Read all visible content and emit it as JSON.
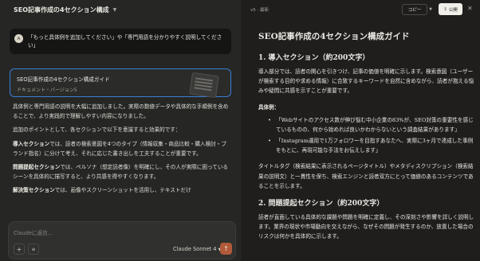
{
  "chat": {
    "title": "SEO記事作成の4セクション構成",
    "user_avatar": "A",
    "user_message": "「もっと具体例を追加してください」や「専門用語を分かりやすく説明してください」",
    "artifact": {
      "title": "SEO記事作成の4セクション構成ガイド",
      "subtitle": "ドキュメント・バージョン5"
    },
    "reply": [
      {
        "bold": "",
        "text": "具体例と専門用語の説明を大幅に追加しました。実際の数値データや具体的な手順例を含めることで、より実践的で理解しやすい内容になりました。"
      },
      {
        "bold": "",
        "text": "追加のポイントとして、各セクションで以下を意識すると効果的です："
      },
      {
        "bold": "導入セクション",
        "text": "では、読者の検索意図を4つのタイプ（情報収集・商品比較・購入検討・ブランド指名）に分けて考え、それに応じた書き出しを工夫することが重要です。"
      },
      {
        "bold": "問題提起セクション",
        "text": "では、ペルソナ（想定読者像）を明確にし、その人が実際に困っているシーンを具体的に描写すると、より共感を得やすくなります。"
      },
      {
        "bold": "解決策セクション",
        "text": "では、画像やスクリーンショットを活用し、テキストだけ"
      }
    ],
    "input_placeholder": "Claudeに返信...",
    "plus_icon": "+",
    "tools_icon": "≡",
    "model": "Claude Sonnet 4",
    "send_icon": "↑"
  },
  "artifact_panel": {
    "version": "v5 · 最新",
    "copy_label": "コピー",
    "publish_label": "公開",
    "doc": {
      "title": "SEO記事作成の4セクション構成ガイド",
      "section1_heading": "1. 導入セクション（約200文字）",
      "section1_para": "導入部分では、読者の関心を引きつけ、記事の価値を明確に示します。検索意図（ユーザーが検索する目的や求める情報）に合致するキーワードを自然に含めながら、読者が抱える悩みや疑問に共感を示すことが重要です。",
      "example_label": "具体例：",
      "examples": [
        "「Webサイトのアクセス数が伸び悩む中小企業の83%が、SEO対策の重要性を感じているものの、何から始めれば良いかわからないという調査結果があります」",
        "「Instagram運用で1万フォロワーを目指すあなたへ、実際に3ヶ月で達成した事例をもとに、再現可能な手法をお伝えします」"
      ],
      "section1_para2": "タイトルタグ（検索結果に表示されるページタイトル）やメタディスクリプション（検索結果の説明文）と一貫性を保ち、検索エンジンと読者双方にとって価値のあるコンテンツであることを示します。",
      "section2_heading": "2. 問題提起セクション（約200文字）",
      "section2_para": "読者が直面している具体的な課題や問題を明確に定義し、その深刻さや影響を詳しく説明します。業界の現状や市場動向を交えながら、なぜその問題が発生するのか、放置した場合のリスクは何かを具体的に示します。"
    }
  }
}
